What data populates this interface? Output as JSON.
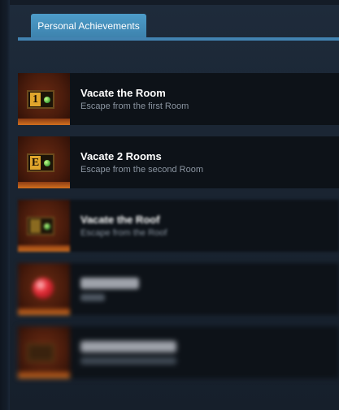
{
  "tab": {
    "label": "Personal Achievements"
  },
  "achievements": [
    {
      "title": "Vacate the Room",
      "description": "Escape from the first Room",
      "badge": "1",
      "icon": "room-1-plate-icon"
    },
    {
      "title": "Vacate 2 Rooms",
      "description": "Escape from the second Room",
      "badge": "E",
      "icon": "room-e-plate-icon"
    },
    {
      "title": "Vacate the Roof",
      "description": "Escape from the Roof",
      "badge": "",
      "icon": "roof-plate-icon"
    },
    {
      "title": "",
      "description": "",
      "badge": "",
      "icon": "red-orb-icon"
    },
    {
      "title": "",
      "description": "",
      "badge": "",
      "icon": "wood-plate-icon"
    }
  ]
}
